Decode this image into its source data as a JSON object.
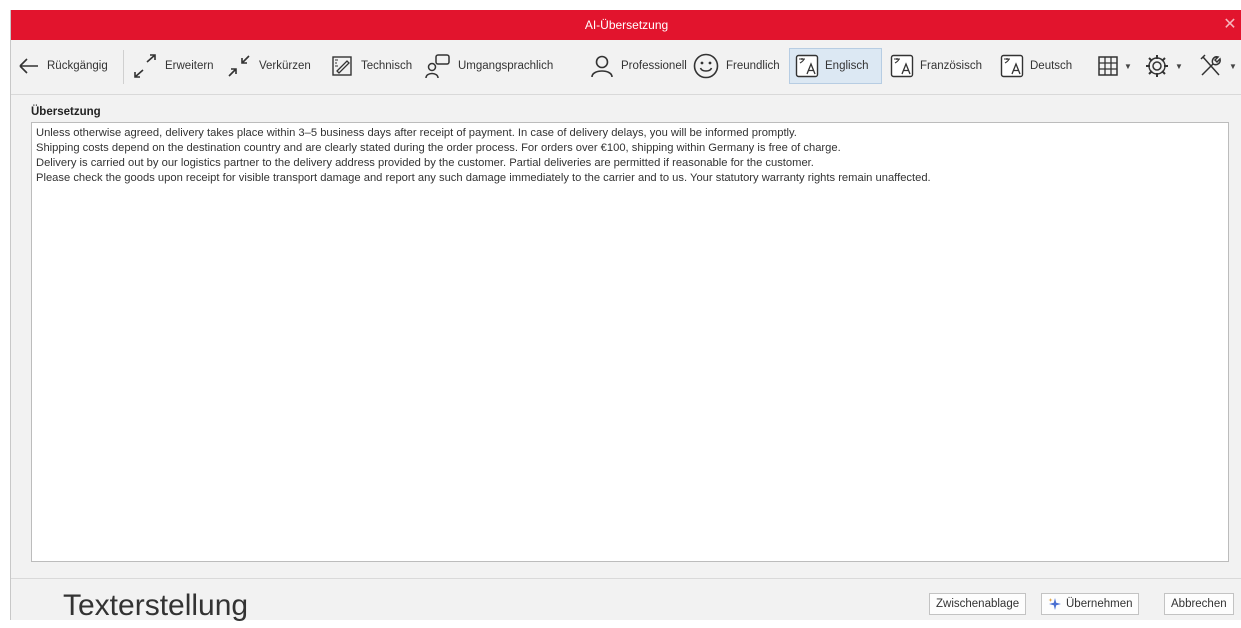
{
  "window": {
    "title": "AI-Übersetzung",
    "close_glyph": "✕",
    "accent_color": "#e2142d"
  },
  "toolbar": {
    "undo": "Rückgängig",
    "expand": "Erweitern",
    "shorten": "Verkürzen",
    "technical": "Technisch",
    "colloquial": "Umgangsprachlich",
    "professional": "Professionell",
    "friendly": "Freundlich",
    "english": "Englisch",
    "french": "Französisch",
    "german": "Deutsch",
    "icons": {
      "undo": "undo-arrow-icon",
      "expand": "expand-icon",
      "shorten": "shrink-icon",
      "technical": "pencil-ruler-icon",
      "colloquial": "speech-bubble-person-icon",
      "professional": "person-icon",
      "friendly": "smiley-icon",
      "translate": "translate-icon",
      "table": "table-grid-icon",
      "settings": "gear-icon",
      "tools": "tools-icon"
    }
  },
  "content": {
    "section_title": "Übersetzung",
    "lines": [
      "Unless otherwise agreed, delivery takes place within 3–5 business days after receipt of payment. In case of delivery delays, you will be informed promptly.",
      "Shipping costs depend on the destination country and are clearly stated during the order process. For orders over €100, shipping within Germany is free of charge.",
      "Delivery is carried out by our logistics partner to the delivery address provided by the customer. Partial deliveries are permitted if reasonable for the customer.",
      "Please check the goods upon receipt for visible transport damage and report any such damage immediately to the carrier and to us. Your statutory warranty rights remain unaffected."
    ]
  },
  "footer": {
    "label": "Texterstellung",
    "clipboard": "Zwischenablage",
    "apply": "Übernehmen",
    "cancel": "Abbrechen"
  }
}
